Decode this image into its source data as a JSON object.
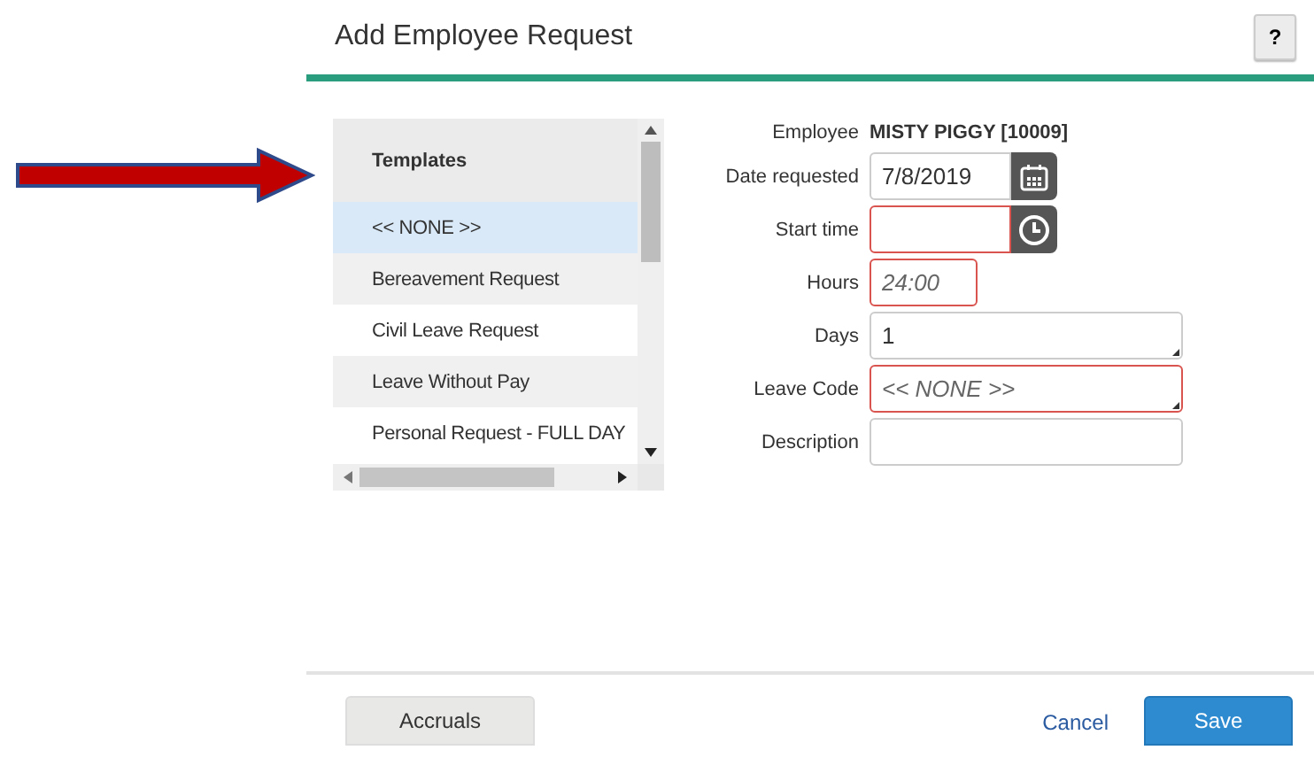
{
  "dialog": {
    "title": "Add Employee Request",
    "help_button": "?"
  },
  "templates": {
    "header": "Templates",
    "items": [
      {
        "label": "<< NONE >>",
        "selected": true
      },
      {
        "label": "Bereavement Request",
        "selected": false
      },
      {
        "label": "Civil Leave Request",
        "selected": false
      },
      {
        "label": "Leave Without Pay",
        "selected": false
      },
      {
        "label": "Personal Request - FULL DAY",
        "selected": false
      }
    ]
  },
  "employee": {
    "label": "Employee",
    "value": "MISTY PIGGY [10009]"
  },
  "fields": [
    {
      "kind": "date",
      "label": "Date requested",
      "value": "7/8/2019",
      "invalid": false
    },
    {
      "kind": "time",
      "label": "Start time",
      "invalid": true
    },
    {
      "kind": "short",
      "label": "Hours",
      "placeholder": "24:00",
      "invalid": true
    },
    {
      "kind": "area",
      "label": "Days",
      "value": "1",
      "invalid": false
    },
    {
      "kind": "area",
      "label": "Leave Code",
      "placeholder": "<< NONE >>",
      "invalid": true
    },
    {
      "kind": "text",
      "label": "Description",
      "invalid": false
    }
  ],
  "footer": {
    "accruals": "Accruals",
    "cancel": "Cancel",
    "save": "Save"
  }
}
